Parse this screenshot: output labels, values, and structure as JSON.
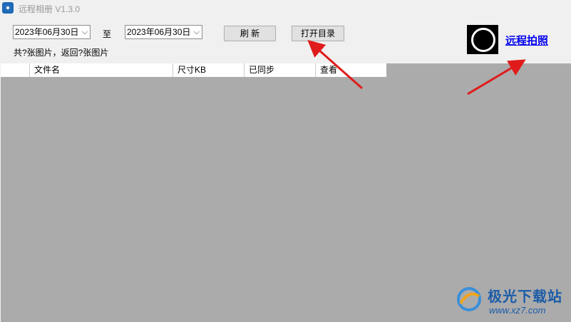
{
  "window": {
    "title": "远程相册 V1.3.0"
  },
  "filters": {
    "start_date": "2023年06月30日",
    "to_label": "至",
    "end_date": "2023年06月30日",
    "dropdown_glyph": "⌵"
  },
  "toolbar": {
    "refresh_label": "刷 新",
    "open_dir_label": "打开目录"
  },
  "summary": "共?张图片，返回?张图片",
  "remote_photo": {
    "link_text": "远程拍照",
    "icon": "camera-lens-icon"
  },
  "table": {
    "columns": [
      "文件名",
      "尺寸KB",
      "已同步",
      "查看"
    ],
    "rows": []
  },
  "watermark": {
    "brand": "极光下载站",
    "url": "www.xz7.com"
  },
  "colors": {
    "grid_background": "#ababab",
    "link": "#0000ee",
    "annotation_arrow": "#e01b1b",
    "watermark": "#1c5ca8"
  }
}
